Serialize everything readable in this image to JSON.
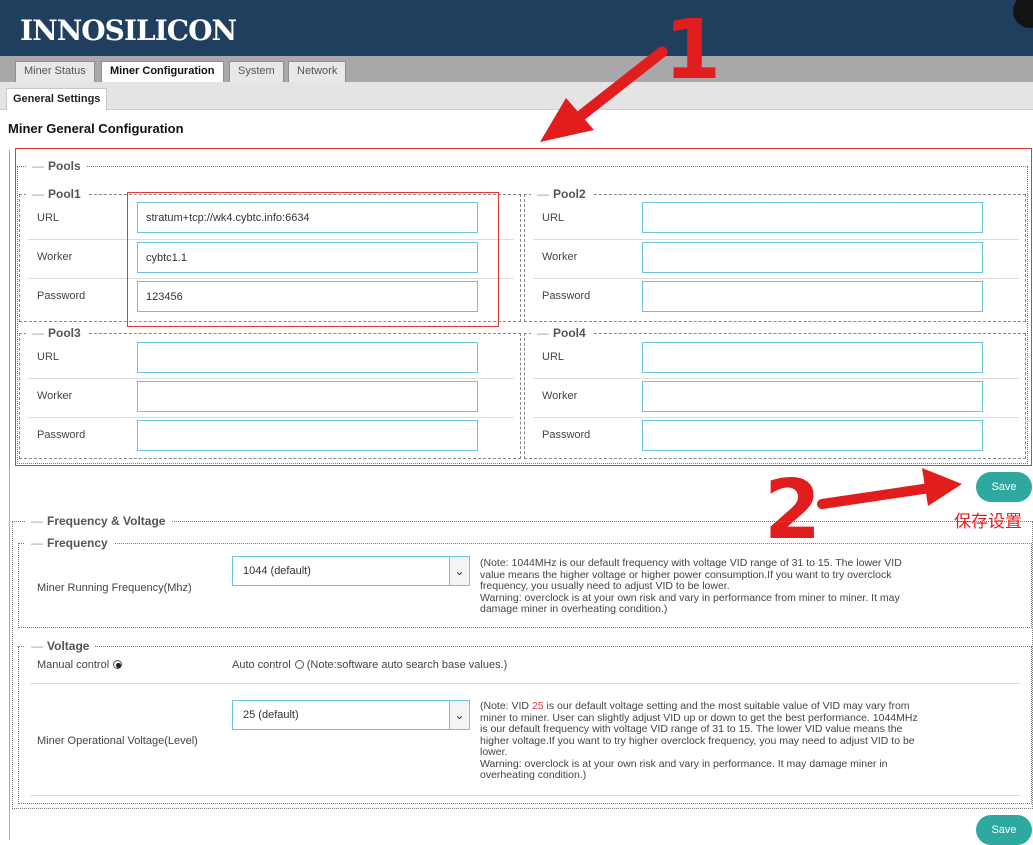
{
  "header": {
    "logo": "INNOSILICON"
  },
  "tabs": [
    {
      "label": "Miner Status",
      "active": false
    },
    {
      "label": "Miner Configuration",
      "active": true
    },
    {
      "label": "System",
      "active": false
    },
    {
      "label": "Network",
      "active": false
    }
  ],
  "subtab": {
    "label": "General Settings"
  },
  "page_title": "Miner General Configuration",
  "pools": {
    "legend": "Pools",
    "url_label": "URL",
    "worker_label": "Worker",
    "password_label": "Password",
    "items": [
      {
        "legend": "Pool1",
        "url": "stratum+tcp://wk4.cybtc.info:6634",
        "worker": "cybtc1.1",
        "password": "123456"
      },
      {
        "legend": "Pool2",
        "url": "",
        "worker": "",
        "password": ""
      },
      {
        "legend": "Pool3",
        "url": "",
        "worker": "",
        "password": ""
      },
      {
        "legend": "Pool4",
        "url": "",
        "worker": "",
        "password": ""
      }
    ]
  },
  "save_label": "Save",
  "annotations": {
    "step1": "1",
    "step2": "2",
    "save_caption": "保存设置",
    "colors": {
      "annotation": "#e21d1d",
      "accent": "#2fa9a0",
      "input_border": "#6cc3dd"
    }
  },
  "freq_voltage": {
    "legend": "Frequency & Voltage",
    "frequency": {
      "legend": "Frequency",
      "label": "Miner Running Frequency(Mhz)",
      "selected": "1044 (default)",
      "note": [
        "(Note: 1044MHz is our default frequency with voltage VID range of 31 to 15. The lower VID",
        "value means the higher voltage or higher power consumption.If you want to try overclock",
        "frequency, you usually need to adjust VID to be lower.",
        "Warning: overclock is at your own risk and vary in performance from miner to miner. It may",
        "damage miner in overheating condition.)"
      ]
    },
    "voltage": {
      "legend": "Voltage",
      "manual_label": "Manual control",
      "manual_checked": true,
      "auto_label": "Auto control",
      "auto_checked": false,
      "auto_note": "(Note:software auto search base values.)",
      "label": "Miner Operational Voltage(Level)",
      "selected": "25 (default)",
      "note_first_prefix": "(Note: VID ",
      "note_vid": "25",
      "note_first_suffix": " is our default voltage setting and the most suitable value of VID may vary from",
      "note": [
        "miner to miner. User can slightly adjust VID up or down to get the best performance. 1044MHz",
        "is our default frequency with voltage VID range of 31 to 15. The lower VID value means the",
        "higher voltage.If you want to try higher overclock frequency, you may need to adjust VID to be",
        "lower.",
        "Warning: overclock is at your own risk and vary in performance. It may damage miner in",
        "overheating condition.)"
      ]
    }
  }
}
